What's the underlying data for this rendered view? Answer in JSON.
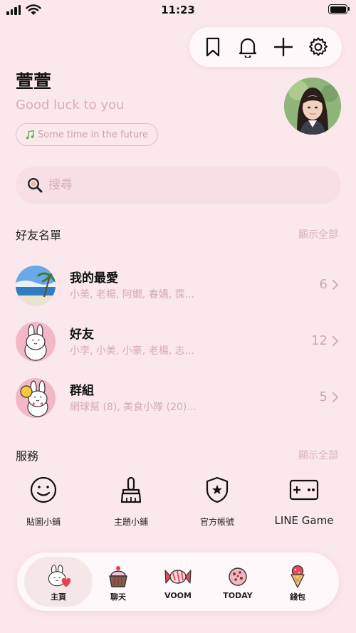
{
  "status_bar": {
    "time": "11:23"
  },
  "header": {
    "actions": [
      {
        "name": "bookmark-icon"
      },
      {
        "name": "bell-icon"
      },
      {
        "name": "plus-icon"
      },
      {
        "name": "settings-icon"
      }
    ]
  },
  "profile": {
    "name": "萱萱",
    "status_message": "Good luck to you",
    "music": "Some time in the future"
  },
  "search": {
    "placeholder": "搜尋"
  },
  "friends_section": {
    "title": "好友名單",
    "see_all": "顯示全部",
    "rows": [
      {
        "title": "我的最愛",
        "subtitle": "小美, 老楊, 阿嫺, 春嬌, 霂...",
        "count": "6"
      },
      {
        "title": "好友",
        "subtitle": "小李, 小美, 小豪, 老楊, 志...",
        "count": "12"
      },
      {
        "title": "群組",
        "subtitle": "網球幫 (8), 美食小隊 (20)...",
        "count": "5"
      }
    ]
  },
  "services_section": {
    "title": "服務",
    "see_all": "顯示全部",
    "items": [
      {
        "label": "貼圖小鋪",
        "icon": "smiley-icon"
      },
      {
        "label": "主題小鋪",
        "icon": "brush-icon"
      },
      {
        "label": "官方帳號",
        "icon": "shield-star-icon"
      },
      {
        "label": "LINE Game",
        "icon": "gamepad-icon"
      }
    ]
  },
  "bottom_nav": {
    "items": [
      {
        "label": "主頁",
        "icon": "home-bunny-icon",
        "active": true
      },
      {
        "label": "聊天",
        "icon": "cupcake-icon"
      },
      {
        "label": "VOOM",
        "icon": "candy-icon"
      },
      {
        "label": "TODAY",
        "icon": "cookie-icon"
      },
      {
        "label": "錢包",
        "icon": "ice-cream-icon"
      }
    ]
  },
  "colors": {
    "background": "#fbe8ec",
    "accent_text": "#d7b0ba",
    "search_bg": "#f8dfe5",
    "pill_bg": "#fff8fa"
  }
}
